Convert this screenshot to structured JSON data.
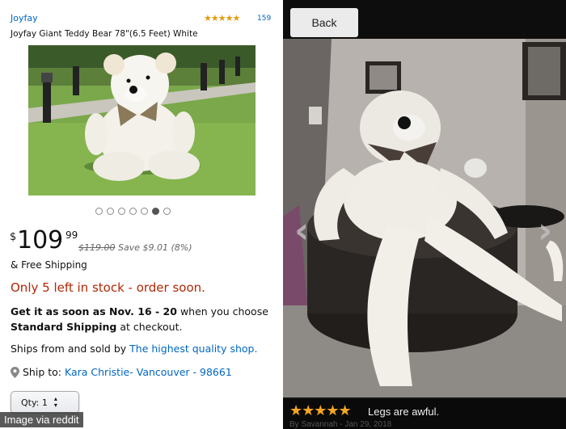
{
  "product": {
    "brand": "Joyfay",
    "stars": "★★★★★",
    "review_count": "159",
    "title": "Joyfay Giant Teddy Bear 78\"(6.5 Feet) White",
    "image_dots": 7,
    "active_dot": 5
  },
  "price": {
    "currency": "$",
    "whole": "109",
    "fraction": "99",
    "was": "$119.00",
    "save": "Save $9.01 (8%)"
  },
  "shipping": {
    "free": "& Free Shipping",
    "stock": "Only 5 left in stock - order soon.",
    "get_it": "Get it as soon as Nov. 16 - 20",
    "when": " when you choose",
    "standard": "Standard Shipping",
    "checkout": " at checkout.",
    "sold_prefix": "Ships from and sold by ",
    "seller": "The highest quality shop.",
    "ship_to_label": "Ship to: ",
    "ship_to_value": "Kara Christie- Vancouver - 98661"
  },
  "qty": {
    "label": "Qty: 1"
  },
  "credit": "Image via reddit",
  "review_viewer": {
    "back_label": "Back",
    "stars": "★★★★★",
    "text": "Legs are awful.",
    "byline": "By Savannah - Jan 29, 2018"
  },
  "colors": {
    "link": "#0066c0",
    "stock": "#b12704",
    "star": "#f5a623"
  }
}
